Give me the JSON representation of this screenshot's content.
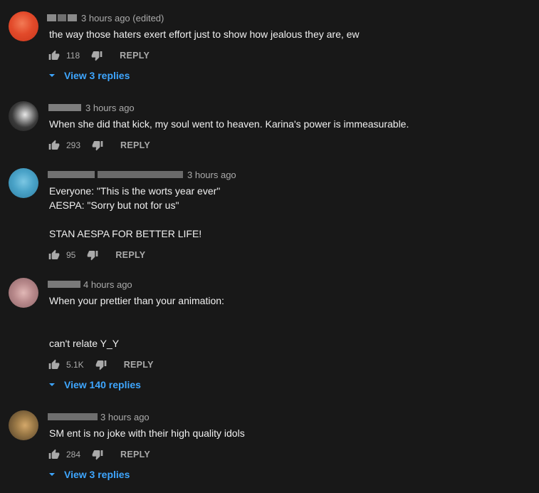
{
  "comments": [
    {
      "time": "3 hours ago (edited)",
      "text": "the way those haters exert effort just to show how jealous they are, ew",
      "likes": "118",
      "reply_label": "REPLY",
      "view_replies": "View 3 replies",
      "avatar_colors": [
        "#e0472a",
        "#f0623d"
      ]
    },
    {
      "time": "3 hours ago",
      "text": "When she did that kick, my soul went to heaven. Karina's power is immeasurable.",
      "likes": "293",
      "reply_label": "REPLY",
      "avatar_colors": [
        "#2c2c2c",
        "#d9d9d9"
      ]
    },
    {
      "time": "3 hours ago",
      "text": "Everyone: \"This is the worts year ever\"\nAESPA: \"Sorry but not for us\"\n\nSTAN AESPA FOR BETTER LIFE!",
      "likes": "95",
      "reply_label": "REPLY",
      "avatar_colors": [
        "#3a8fb3",
        "#5fb4d6"
      ]
    },
    {
      "time": "4 hours ago",
      "text": "When your prettier than your animation:\n\n\ncan't relate Y_Y",
      "likes": "5.1K",
      "reply_label": "REPLY",
      "view_replies": "View 140 replies",
      "avatar_colors": [
        "#b07a80",
        "#d9a8a8"
      ]
    },
    {
      "time": "3 hours ago",
      "text": "SM ent is no joke with their high quality idols",
      "likes": "284",
      "reply_label": "REPLY",
      "view_replies": "View 3 replies",
      "avatar_colors": [
        "#6b5231",
        "#c29a5e"
      ]
    }
  ],
  "colors": {
    "background": "#181818",
    "text": "#f1f1f1",
    "secondary": "#aaaaaa",
    "link": "#3ea6ff"
  },
  "icons": [
    "thumb-up-icon",
    "thumb-down-icon",
    "chevron-down-icon"
  ]
}
